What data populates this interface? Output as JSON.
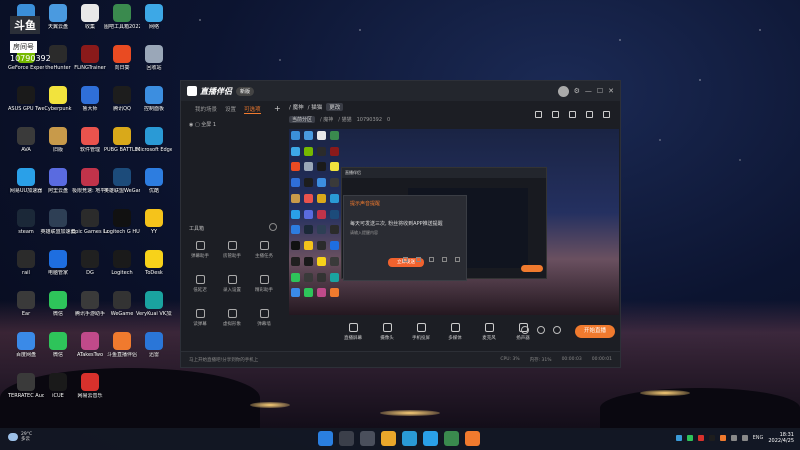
{
  "room": {
    "logo_text": "斗鱼",
    "label": "房间号",
    "id": "10790392"
  },
  "desktop_icons": [
    {
      "label": "此电脑",
      "color": "#3b8fd9"
    },
    {
      "label": "天翼云盘",
      "color": "#4a9ae0"
    },
    {
      "label": "收集",
      "color": "#e8e8e8"
    },
    {
      "label": "图吧工具箱2022",
      "color": "#3a8a4e"
    },
    {
      "label": "网络",
      "color": "#3da8e6"
    },
    {
      "label": "GeForce Experience",
      "color": "#76b900"
    },
    {
      "label": "theHunter",
      "color": "#2b2b2b"
    },
    {
      "label": "FLiNGTrainer",
      "color": "#8a1a1a"
    },
    {
      "label": "向日葵",
      "color": "#e94b22"
    },
    {
      "label": "回收站",
      "color": "#9aa7b8"
    },
    {
      "label": "ASUS GPU TweakII",
      "color": "#1a1a1a"
    },
    {
      "label": "Cyberpunk",
      "color": "#f2e33d"
    },
    {
      "label": "鲁大师",
      "color": "#2f6fd8"
    },
    {
      "label": "腾讯QQ",
      "color": "#1d1d1d"
    },
    {
      "label": "控制面板",
      "color": "#3c8ee0"
    },
    {
      "label": "AVA",
      "color": "#3a3a3a"
    },
    {
      "label": "旧版",
      "color": "#c89a4a"
    },
    {
      "label": "软件管理",
      "color": "#e9534d"
    },
    {
      "label": "PUBG BATTLEGR...",
      "color": "#d9a91a"
    },
    {
      "label": "Microsoft Edge",
      "color": "#2a9ad6"
    },
    {
      "label": "网易UU加速器",
      "color": "#2aa0e8"
    },
    {
      "label": "阿里云盘",
      "color": "#5a6be0"
    },
    {
      "label": "极限竞速: 地平线5",
      "color": "#c0334a"
    },
    {
      "label": "英雄联盟WeGame",
      "color": "#1c4b7a"
    },
    {
      "label": "优酷",
      "color": "#2d7de0"
    },
    {
      "label": "steam",
      "color": "#1b2838"
    },
    {
      "label": "英雄联盟加速器",
      "color": "#2e3f55"
    },
    {
      "label": "Epic Games Launcher",
      "color": "#2b2b2b"
    },
    {
      "label": "Logitech G HUB",
      "color": "#111"
    },
    {
      "label": "YY",
      "color": "#f5c31b"
    },
    {
      "label": "rail",
      "color": "#2b2b2b"
    },
    {
      "label": "电脑管家",
      "color": "#1e6ee0"
    },
    {
      "label": "DG",
      "color": "#202020"
    },
    {
      "label": "Logitech",
      "color": "#1a1a1a"
    },
    {
      "label": "ToDesk",
      "color": "#f7d21a"
    },
    {
      "label": "Ear",
      "color": "#3a3a3a"
    },
    {
      "label": "微信",
      "color": "#2ec45a"
    },
    {
      "label": "腾讯手游助手",
      "color": "#3a3a3a"
    },
    {
      "label": "WeGame",
      "color": "#333"
    },
    {
      "label": "VeryKuai VK加速器",
      "color": "#1aa3a0"
    },
    {
      "label": "百度网盘",
      "color": "#3a8ae8"
    },
    {
      "label": "微信",
      "color": "#2ec45a"
    },
    {
      "label": "ATakesTwo",
      "color": "#c04a8a"
    },
    {
      "label": "斗鱼直播伴侣",
      "color": "#f07a2e"
    },
    {
      "label": "迅雷",
      "color": "#2a76d8"
    },
    {
      "label": "TERRATEC Audio C...",
      "color": "#3a3a3a"
    },
    {
      "label": "iCUE",
      "color": "#1a1a1a"
    },
    {
      "label": "网易云音乐",
      "color": "#d8312c"
    }
  ],
  "app": {
    "title": "直播伴侣",
    "badge": "新版",
    "tabs": [
      "我的场景",
      "设置",
      "可选项"
    ],
    "scene_item": "全屏 1",
    "tools_title": "工具箱",
    "tools": [
      "弹幕助手",
      "房管助手",
      "主播任务",
      "低延迟",
      "录入设置",
      "精彩助手",
      "读弹幕",
      "虚拟形象",
      "弹幕墙"
    ],
    "breadcrumb": [
      "/ 魔神",
      "/ 猫猫",
      "更改"
    ],
    "sub": [
      "当前分区",
      "/ 魔神",
      "/ 猫猫",
      "10790392",
      "0"
    ],
    "popup": {
      "header": "提示声音提醒",
      "body": "每天可发送三次, 粉丝将收到APP推送提醒",
      "caption": "请输入提醒内容",
      "button": "立即发送"
    },
    "bottom_tools": [
      "直播屏幕",
      "摄像头",
      "手机投屏",
      "多媒体",
      "麦克风",
      "扬声器"
    ],
    "live_button": "开始直播",
    "status_left": "马上开始直播吧!分享到你的手机上",
    "status_right": [
      "CPU: 3%",
      "内存: 31%",
      "00:00:03",
      "00:00:01"
    ]
  },
  "taskbar": {
    "weather_temp": "29°C",
    "weather_text": "多云",
    "lang": "ENG",
    "time": "18:31",
    "date": "2022/4/25"
  }
}
